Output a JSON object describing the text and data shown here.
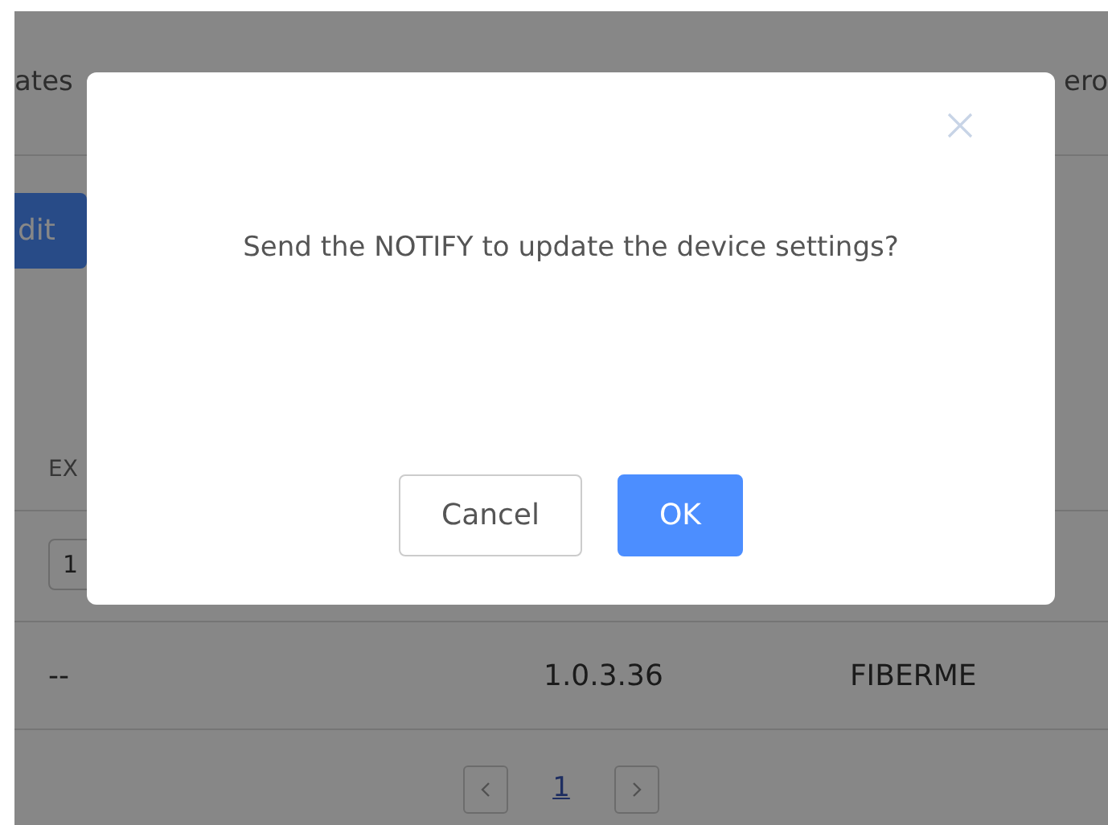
{
  "background": {
    "tabs": [
      "ates",
      "ero"
    ],
    "edit_button": "dit",
    "table": {
      "columns": [
        "EX"
      ],
      "filter_value": "1",
      "rows": [
        {
          "cells": [
            "--",
            "1.0.3.36",
            "FIBERME"
          ]
        }
      ]
    },
    "pagination": {
      "pages": [
        {
          "label": "1",
          "selected": true
        }
      ]
    }
  },
  "dialog": {
    "message": "Send the NOTIFY to update the device settings?",
    "buttons": [
      {
        "label": "Cancel",
        "kind": "secondary"
      },
      {
        "label": "OK",
        "kind": "primary"
      }
    ]
  }
}
